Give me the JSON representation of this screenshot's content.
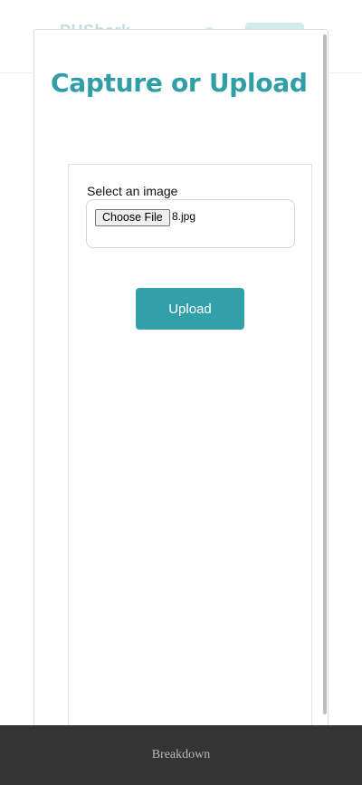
{
  "background": {
    "logo_text": "PHShark"
  },
  "modal": {
    "title": "Capture or Upload",
    "file_input": {
      "label": "Select an image",
      "button_label": "Choose File",
      "selected_file": "8.jpg"
    },
    "upload_button": "Upload"
  },
  "footer": {
    "link_label": "Breakdown"
  },
  "colors": {
    "accent": "#2f9ea7",
    "footer_bg": "#343434"
  }
}
